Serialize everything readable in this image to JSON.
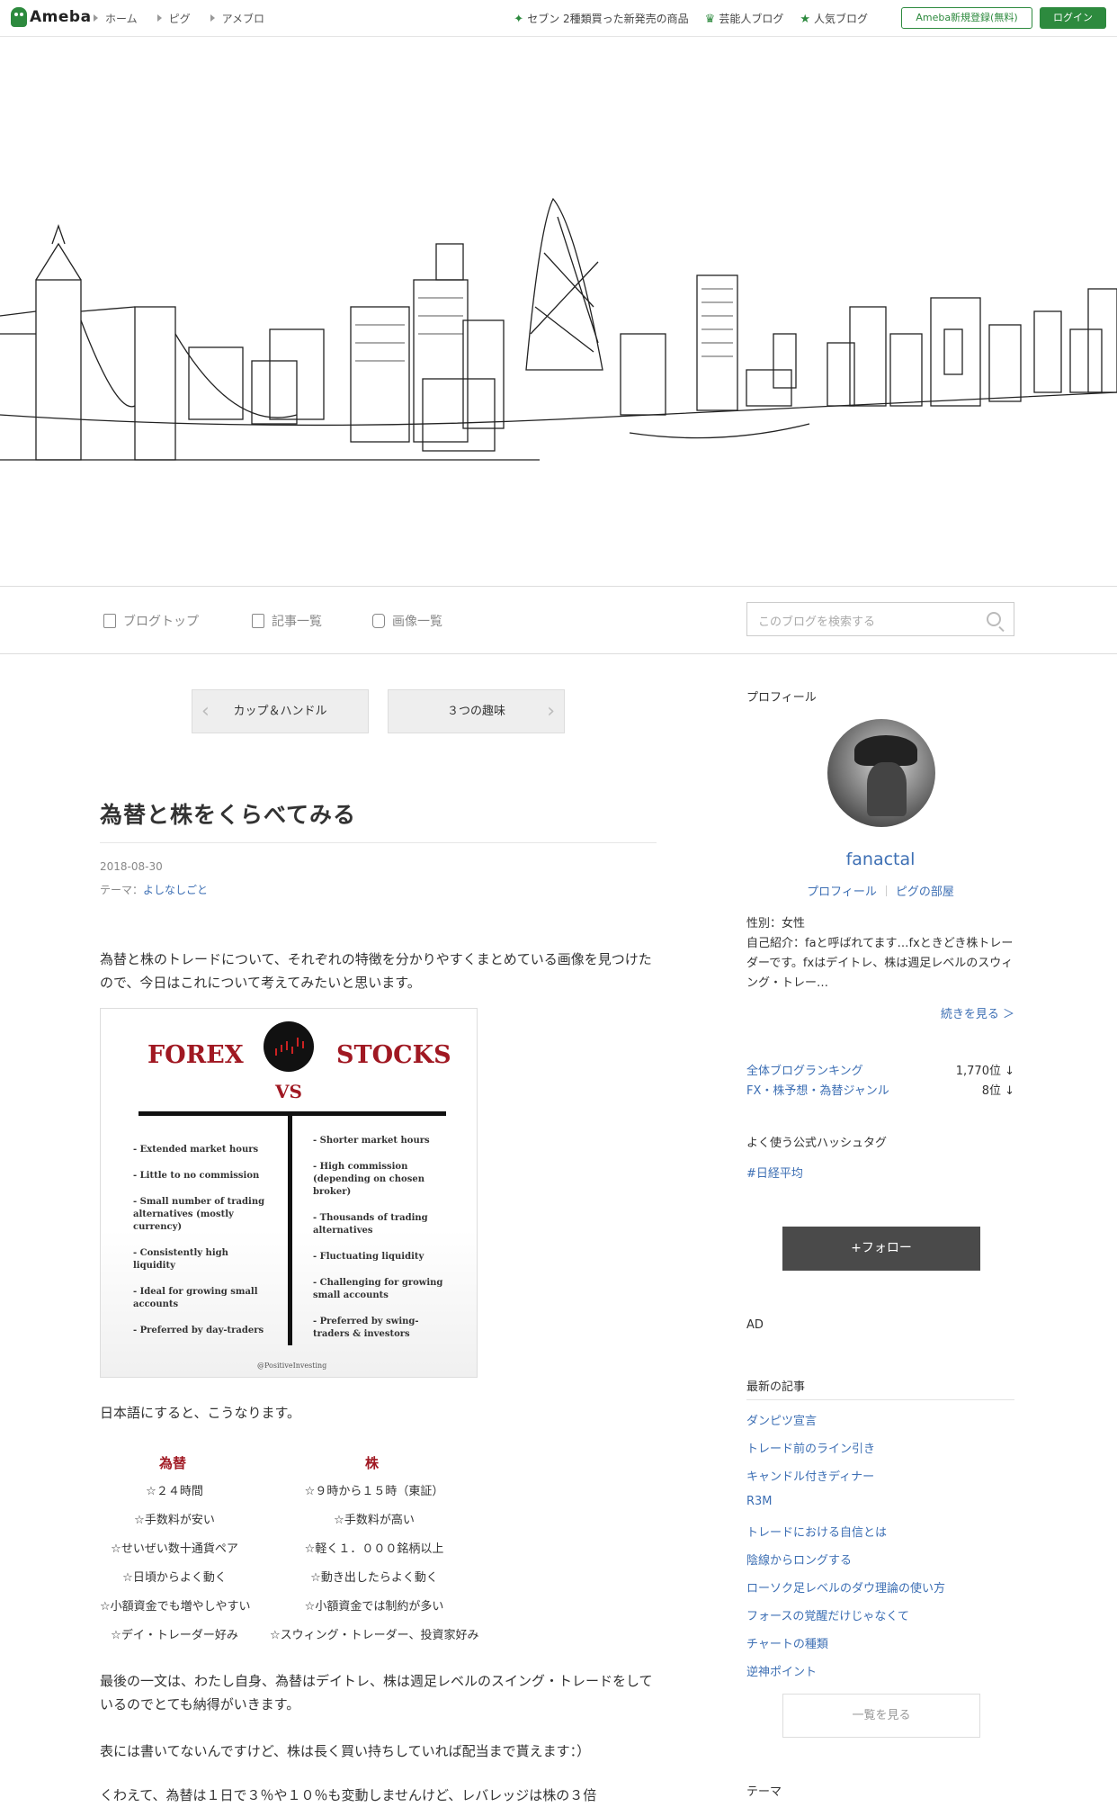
{
  "topbar": {
    "logo": "Ameba",
    "crumbs": [
      "ホーム",
      "ピグ",
      "アメブロ"
    ],
    "links": [
      "セブン 2種類買った新発売の商品",
      "芸能人ブログ",
      "人気ブログ"
    ],
    "register": "Ameba新規登録(無料)",
    "login": "ログイン"
  },
  "nav": {
    "items": [
      "ブログトップ",
      "記事一覧",
      "画像一覧"
    ],
    "search_placeholder": "このブログを検索する"
  },
  "pager": {
    "prev": "カップ＆ハンドル",
    "next": "３つの趣味"
  },
  "article": {
    "title": "為替と株をくらべてみる",
    "date": "2018-08-30",
    "theme_prefix": "テーマ：",
    "theme": "よしなしごと",
    "p1": "為替と株のトレードについて、それぞれの特徴を分かりやすくまとめている画像を見つけたので、今日はこれについて考えてみたいと思います。",
    "figure": {
      "left_title": "FOREX",
      "right_title": "STOCKS",
      "vs": "VS",
      "left_items": [
        "- Extended market hours",
        "- Little to no commission",
        "- Small number of trading alternatives (mostly currency)",
        "- Consistently high liquidity",
        "- Ideal for growing small accounts",
        "- Preferred by day-traders"
      ],
      "right_items": [
        "- Shorter market hours",
        "- High commission (depending on chosen broker)",
        "- Thousands of trading alternatives",
        "- Fluctuating liquidity",
        "- Challenging for growing small accounts",
        "- Preferred by swing-traders & investors"
      ],
      "credit": "@PositiveInvesting"
    },
    "p2": "日本語にすると、こうなります。",
    "compare": {
      "left_head": "為替",
      "right_head": "株",
      "left": [
        "☆２４時間",
        "☆手数料が安い",
        "☆せいぜい数十通貨ペア",
        "☆日頃からよく動く",
        "☆小額資金でも増やしやすい",
        "☆デイ・トレーダー好み"
      ],
      "right": [
        "☆９時から１５時（東証）",
        "☆手数料が高い",
        "☆軽く１．０００銘柄以上",
        "☆動き出したらよく動く",
        "☆小額資金では制約が多い",
        "☆スウィング・トレーダー、投資家好み"
      ]
    },
    "p3": "最後の一文は、わたし自身、為替はデイトレ、株は週足レベルのスイング・トレードをしているのでとても納得がいきます。",
    "p4": "表には書いてないんですけど、株は長く買い持ちしていれば配当まで貰えます：）",
    "p5": "くわえて、為替は１日で３％や１０％も変動しませんけど、レバレッジは株の３倍"
  },
  "sidebar": {
    "profile_head": "プロフィール",
    "name": "fanactal",
    "profile_link": "プロフィール",
    "room_link": "ピグの部屋",
    "gender": "性別：女性",
    "intro": "自己紹介：faと呼ばれてます…fxときどき株トレーダーです。fxはデイトレ、株は週足レベルのスウィング・トレー…",
    "more": "続きを見る ＞",
    "rank1_label": "全体ブログランキング",
    "rank1_value": "1,770位 ↓",
    "rank2_label": "FX・株予想・為替ジャンル",
    "rank2_value": "8位 ↓",
    "hashtag_head": "よく使う公式ハッシュタグ",
    "hashtag": "#日経平均",
    "follow": "+フォロー",
    "ad": "AD",
    "recent_head": "最新の記事",
    "recent": [
      "ダンピツ宣言",
      "トレード前のライン引き",
      "キャンドル付きディナー",
      "R3M",
      "トレードにおける自信とは",
      "陰線からロングする",
      "ローソク足レベルのダウ理論の使い方",
      "フォースの覚醒だけじゃなくて",
      "チャートの種類",
      "逆神ポイント"
    ],
    "list_more": "一覧を見る",
    "theme_head": "テーマ"
  },
  "colors": {
    "brand": "#2d8a3e",
    "link": "#3d6fb4",
    "accent_red": "#a01822"
  }
}
